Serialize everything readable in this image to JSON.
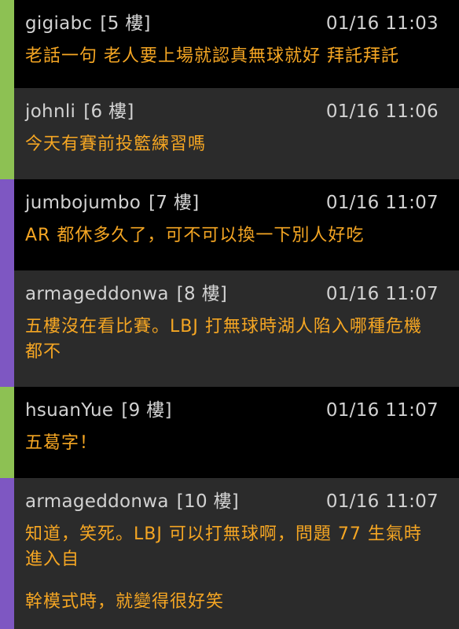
{
  "colors": {
    "bar_green": "#8dc153",
    "bar_purple": "#7e57c2",
    "text_author": "#d2d2d2",
    "text_content": "#f5a623",
    "row_dark": "#000000",
    "row_light": "#2b2b2b"
  },
  "comments": [
    {
      "author": "gigiabc",
      "floor": "[5 樓]",
      "time": "01/16 11:03",
      "lines": [
        "老話一句 老人要上場就認真無球就好 拜託拜託"
      ]
    },
    {
      "author": "johnli",
      "floor": "[6 樓]",
      "time": "01/16 11:06",
      "lines": [
        "今天有賽前投籃練習嗎"
      ]
    },
    {
      "author": "jumbojumbo",
      "floor": "[7 樓]",
      "time": "01/16 11:07",
      "lines": [
        "AR 都休多久了，可不可以換一下別人好吃"
      ]
    },
    {
      "author": "armageddonwa",
      "floor": "[8 樓]",
      "time": "01/16 11:07",
      "lines": [
        "五樓沒在看比賽。LBJ 打無球時湖人陷入哪種危機都不"
      ]
    },
    {
      "author": "hsuanYue",
      "floor": "[9 樓]",
      "time": "01/16 11:07",
      "lines": [
        "五葛字！"
      ]
    },
    {
      "author": "armageddonwa",
      "floor": "[10 樓]",
      "time": "01/16 11:07",
      "lines": [
        "知道，笑死。LBJ 可以打無球啊，問題 77 生氣時進入自",
        "幹模式時，就變得很好笑"
      ]
    }
  ]
}
